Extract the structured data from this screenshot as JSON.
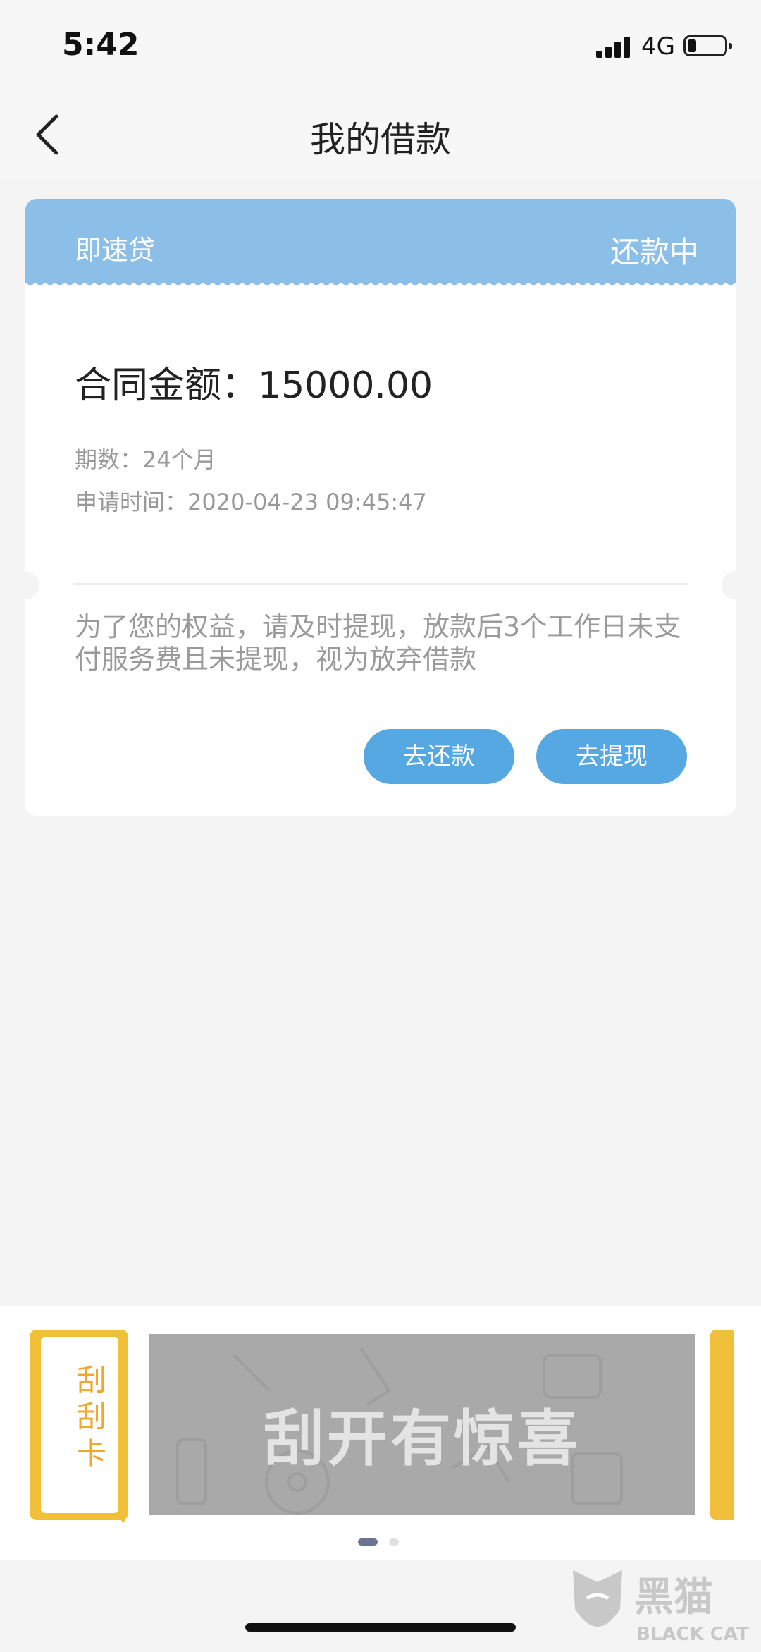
{
  "status_bar": {
    "time": "5:42",
    "network": "4G",
    "battery_level": 0.2
  },
  "nav": {
    "title": "我的借款",
    "back_icon": "chevron-left-icon"
  },
  "loan": {
    "product": "即速贷",
    "status": "还款中",
    "amount_label": "合同金额：15000.00",
    "term": "期数：24个月",
    "applied_at": "申请时间：2020-04-23 09:45:47",
    "notice": "为了您的权益，请及时提现，放款后3个工作日未支付服务费且未提现，视为放弃借款",
    "repay_button": "去还款",
    "withdraw_button": "去提现",
    "accent": "#55a8e2",
    "header_color": "#8cbfe8"
  },
  "scratch_card": {
    "label": "刮刮卡",
    "cover_text": "刮开有惊喜",
    "accent": "#f2bf3b",
    "pages": 2,
    "active_page": 1
  },
  "watermark": {
    "text": "黑猫",
    "subtext": "BLACK CAT"
  }
}
